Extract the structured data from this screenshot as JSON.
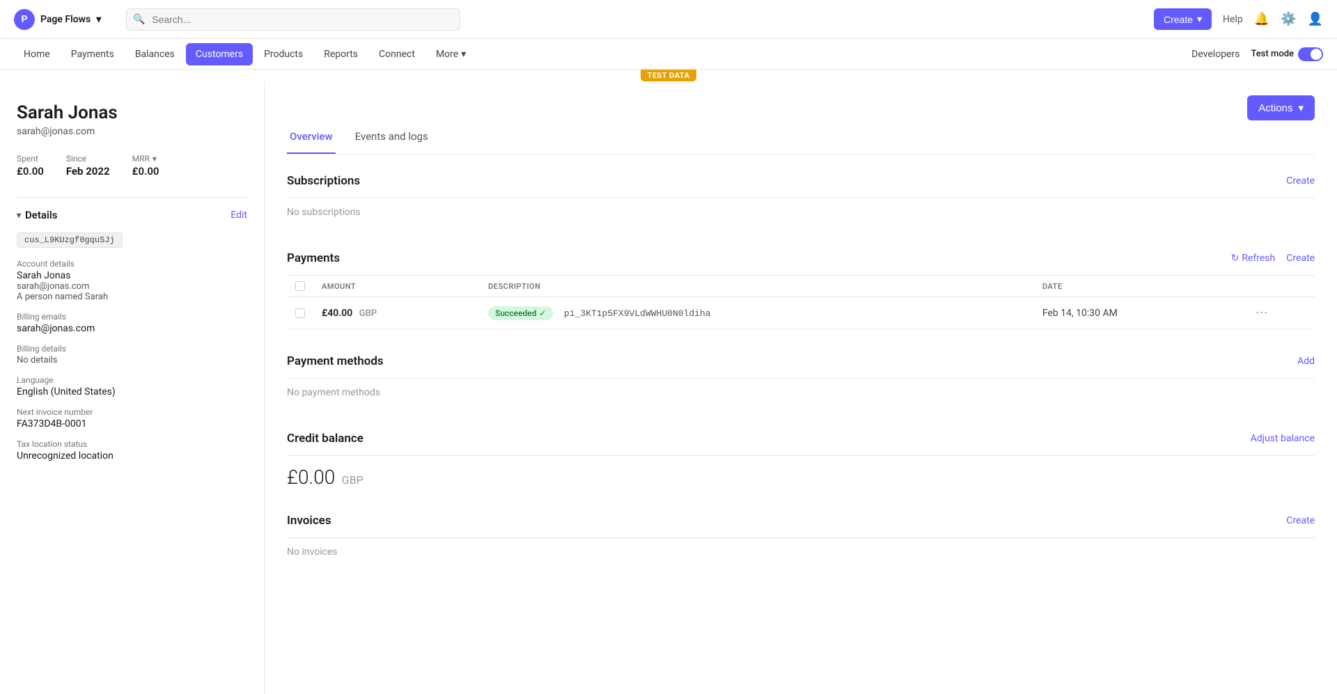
{
  "app": {
    "name": "Page Flows",
    "logo_letter": "P"
  },
  "topbar": {
    "search_placeholder": "Search...",
    "create_label": "Create",
    "help_label": "Help",
    "test_mode_label": "Test mode"
  },
  "navbar": {
    "items": [
      {
        "label": "Home",
        "active": false
      },
      {
        "label": "Payments",
        "active": false
      },
      {
        "label": "Balances",
        "active": false
      },
      {
        "label": "Customers",
        "active": true
      },
      {
        "label": "Products",
        "active": false
      },
      {
        "label": "Reports",
        "active": false
      },
      {
        "label": "Connect",
        "active": false
      },
      {
        "label": "More",
        "active": false
      }
    ],
    "developers_label": "Developers"
  },
  "test_banner": "TEST DATA",
  "customer": {
    "name": "Sarah Jonas",
    "email": "sarah@jonas.com",
    "spent_label": "Spent",
    "spent_value": "£0.00",
    "since_label": "Since",
    "since_value": "Feb 2022",
    "mrr_label": "MRR",
    "mrr_value": "£0.00"
  },
  "details": {
    "title": "Details",
    "edit_label": "Edit",
    "customer_id": "cus_L9KUzgf0gquSJj",
    "account_details_label": "Account details",
    "account_name": "Sarah Jonas",
    "account_email": "sarah@jonas.com",
    "account_desc": "A person named Sarah",
    "billing_emails_label": "Billing emails",
    "billing_email": "sarah@jonas.com",
    "billing_details_label": "Billing details",
    "billing_details_value": "No details",
    "language_label": "Language",
    "language_value": "English (United States)",
    "next_invoice_label": "Next invoice number",
    "next_invoice_value": "FA373D4B-0001",
    "tax_location_label": "Tax location status",
    "tax_location_value": "Unrecognized location"
  },
  "tabs": [
    {
      "label": "Overview",
      "active": true
    },
    {
      "label": "Events and logs",
      "active": false
    }
  ],
  "actions_label": "Actions",
  "sections": {
    "subscriptions": {
      "title": "Subscriptions",
      "create_label": "Create",
      "empty_message": "No subscriptions"
    },
    "payments": {
      "title": "Payments",
      "refresh_label": "Refresh",
      "create_label": "Create",
      "columns": [
        "AMOUNT",
        "DESCRIPTION",
        "DATE"
      ],
      "rows": [
        {
          "amount": "£40.00",
          "currency": "GBP",
          "status": "Succeeded",
          "description": "pi_3KT1p5FX9VLdWWHU0N0ldiha",
          "date": "Feb 14, 10:30 AM"
        }
      ]
    },
    "payment_methods": {
      "title": "Payment methods",
      "add_label": "Add",
      "empty_message": "No payment methods"
    },
    "credit_balance": {
      "title": "Credit balance",
      "adjust_label": "Adjust balance",
      "amount": "£0.00",
      "currency": "GBP"
    },
    "invoices": {
      "title": "Invoices",
      "create_label": "Create",
      "empty_message": "No invoices"
    }
  }
}
